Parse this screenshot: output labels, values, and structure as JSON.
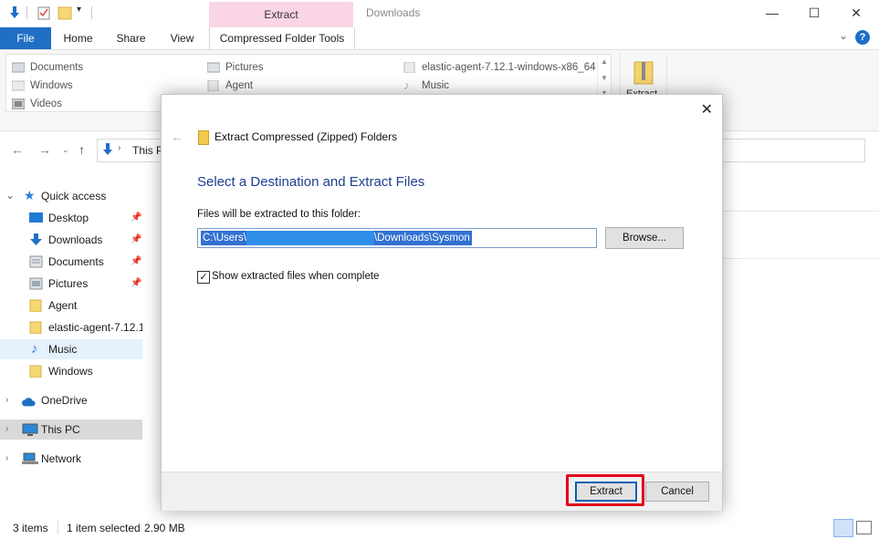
{
  "window": {
    "context_tab": "Extract",
    "title": "Downloads"
  },
  "ribbon_tabs": {
    "file": "File",
    "home": "Home",
    "share": "Share",
    "view": "View",
    "compressed": "Compressed Folder Tools"
  },
  "ribbon": {
    "gallery": [
      "Documents",
      "Windows",
      "Videos",
      "Pictures",
      "Agent",
      "elastic-agent-7.12.1-windows-x86_64",
      "Music"
    ],
    "extract_label": "Extract"
  },
  "address": {
    "path_partial": "This P"
  },
  "nav": {
    "quick_access": "Quick access",
    "items": [
      "Desktop",
      "Downloads",
      "Documents",
      "Pictures",
      "Agent",
      "elastic-agent-7.12.1",
      "Music",
      "Windows"
    ],
    "onedrive": "OneDrive",
    "this_pc": "This PC",
    "network": "Network"
  },
  "status": {
    "items": "3 items",
    "selected": "1 item selected",
    "size": "2.90 MB"
  },
  "dialog": {
    "window_title": "Extract Compressed (Zipped) Folders",
    "heading": "Select a Destination and Extract Files",
    "label": "Files will be extracted to this folder:",
    "path_prefix": "C:\\Users\\",
    "path_suffix": "\\Downloads\\Sysmon",
    "browse": "Browse...",
    "checkbox_label": "Show extracted files when complete",
    "checkbox_checked": true,
    "extract": "Extract",
    "cancel": "Cancel"
  },
  "colors": {
    "accent": "#1f6fc5",
    "context_tab": "#f9d5e5",
    "highlight_box": "#e3001b",
    "heading_blue": "#1f3f8f"
  }
}
